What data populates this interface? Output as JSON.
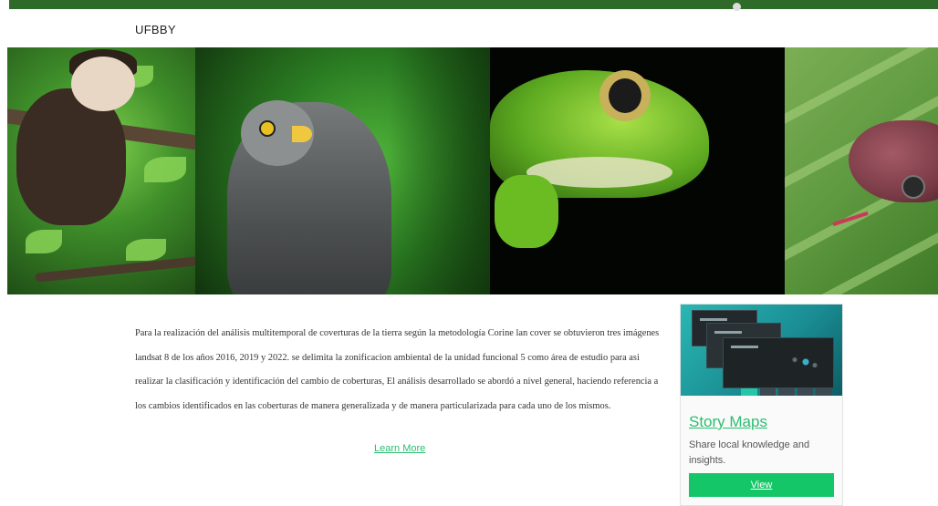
{
  "header": {
    "site_title": "UFBBY"
  },
  "banner": {
    "panels": [
      "monkey-photo",
      "hawk-photo",
      "frog-photo",
      "snake-photo"
    ]
  },
  "main": {
    "description": "Para la realización del análisis multitemporal de coverturas de la tierra según la metodología Corine lan cover se obtuvieron tres imágenes landsat 8 de los años 2016, 2019 y 2022. se delimita la zonificacion ambiental de la unidad funcional 5 como área de estudio para asi realizar la  clasificación y identificación del cambio de coberturas, El análisis desarrollado se abordó a nivel general, haciendo referencia a los cambios identificados en las coberturas de manera generalizada y de manera particularizada para cada uno de los mismos.",
    "learn_more_label": "Learn More"
  },
  "card": {
    "title": "Story Maps",
    "text": "Share local knowledge and insights.",
    "button_label": "View"
  },
  "colors": {
    "topbar": "#2f6b28",
    "link": "#2bbd70",
    "button": "#14c667"
  }
}
